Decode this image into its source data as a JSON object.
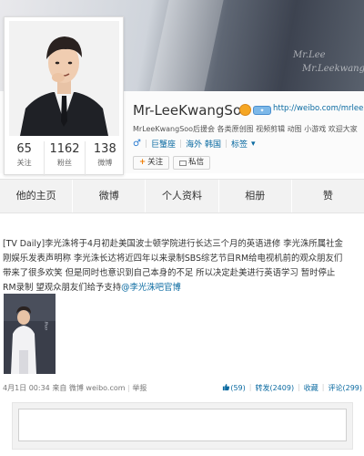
{
  "cover": {
    "text1": "Mr.Lee",
    "text2": "Mr.Leekwang"
  },
  "profile": {
    "name": "Mr-LeeKwangSoo",
    "url": "http://weibo.com/mrlee",
    "description": "MrLeeKwangSoo后援会 各类原创图 视频剪辑 动图 小游戏 欢迎大家",
    "location_label": "巨蟹座",
    "region": "海外 韩国",
    "tags_label": "标签",
    "follow_label": "关注",
    "message_label": "私信",
    "stats": [
      {
        "value": "65",
        "label": "关注"
      },
      {
        "value": "1162",
        "label": "粉丝"
      },
      {
        "value": "138",
        "label": "微博"
      }
    ]
  },
  "tabs": [
    "他的主页",
    "微博",
    "个人资料",
    "相册",
    "赞"
  ],
  "post": {
    "line1": "[TV Daily]李光洙将于4月初赴美国波士顿学院进行长达三个月的英语进修 李光洙所属社金",
    "line2": "刚娱乐发表声明称 李光洙长达将近四年以来录制SBS综艺节目RM给电视机前的观众朋友们",
    "line3": "带来了很多欢笑 但是同时也意识到自己本身的不足 所以决定赴美进行英语学习 暂时停止",
    "line4_prefix": "RM录制 望观众朋友们给予支持",
    "mention": "@李光洙吧官博",
    "time": "4月1日 00:34",
    "source_prefix": "来自",
    "source": "微博 weibo.com",
    "report": "举报",
    "likes": "(59)",
    "repost": "转发(2409)",
    "favorite": "收藏",
    "comment": "评论(299)"
  },
  "colors": {
    "link": "#0a6aa1",
    "accent": "#f07b00"
  }
}
